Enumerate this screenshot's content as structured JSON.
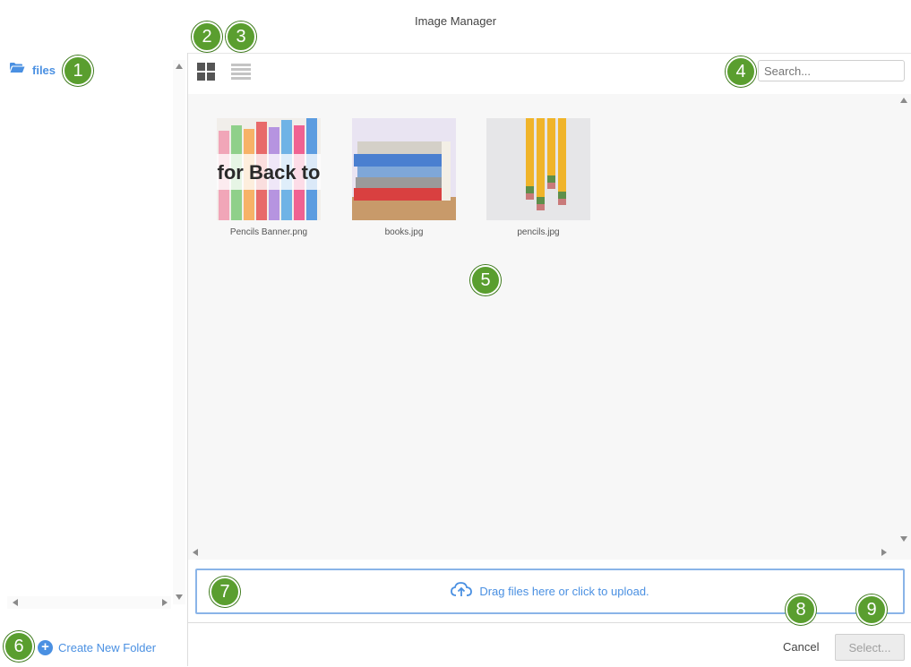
{
  "window": {
    "title": "Image Manager"
  },
  "sidebar": {
    "folder": {
      "label": "files",
      "icon": "folder-open-icon"
    },
    "create_folder_label": "Create New Folder"
  },
  "toolbar": {
    "grid_view_icon": "grid-view-icon",
    "list_view_icon": "list-view-icon",
    "search_placeholder": "Search...",
    "search_value": ""
  },
  "files": [
    {
      "name": "Pencils Banner.png",
      "overlay_text": "for Back to"
    },
    {
      "name": "books.jpg"
    },
    {
      "name": "pencils.jpg"
    }
  ],
  "upload": {
    "label": "Drag files here or click to upload.",
    "icon": "cloud-upload-icon"
  },
  "footer": {
    "cancel_label": "Cancel",
    "select_label": "Select..."
  },
  "callouts": [
    "1",
    "2",
    "3",
    "4",
    "5",
    "6",
    "7",
    "8",
    "9"
  ],
  "colors": {
    "accent": "#4a90e2",
    "badge": "#5a9e2f",
    "content_bg": "#f7f7f7"
  }
}
